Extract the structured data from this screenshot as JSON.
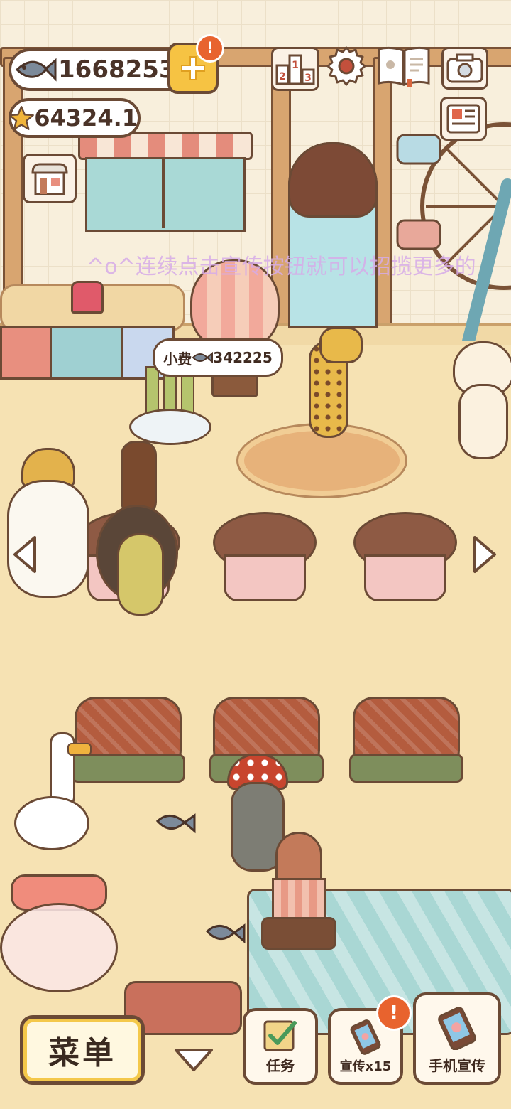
{
  "currency": {
    "fish_amount": "16682535",
    "star_amount": "64324.1"
  },
  "marquee_text": "^o^连续点击宣传按钮就可以招揽更多的",
  "tip_bubble": {
    "label": "小费",
    "amount": "342225"
  },
  "badges": {
    "add_currency": "!",
    "promote": "!"
  },
  "bottom_bar": {
    "menu_label": "菜单",
    "tasks_label": "任务",
    "promote_label": "宣传x15",
    "phone_promote_label": "手机宣传"
  },
  "colors": {
    "outline": "#6b4a35",
    "badge": "#e8632e",
    "menu_highlight": "#f4c84a",
    "floor": "#f6e2b3"
  },
  "icons": [
    "fish-icon",
    "star-icon",
    "plus-icon",
    "ranking-icon",
    "gear-icon",
    "recipe-book-icon",
    "camera-icon",
    "newspaper-icon",
    "shop-icon",
    "arrow-left-icon",
    "arrow-right-icon",
    "chevron-down-icon",
    "checklist-icon",
    "phone-icon"
  ]
}
